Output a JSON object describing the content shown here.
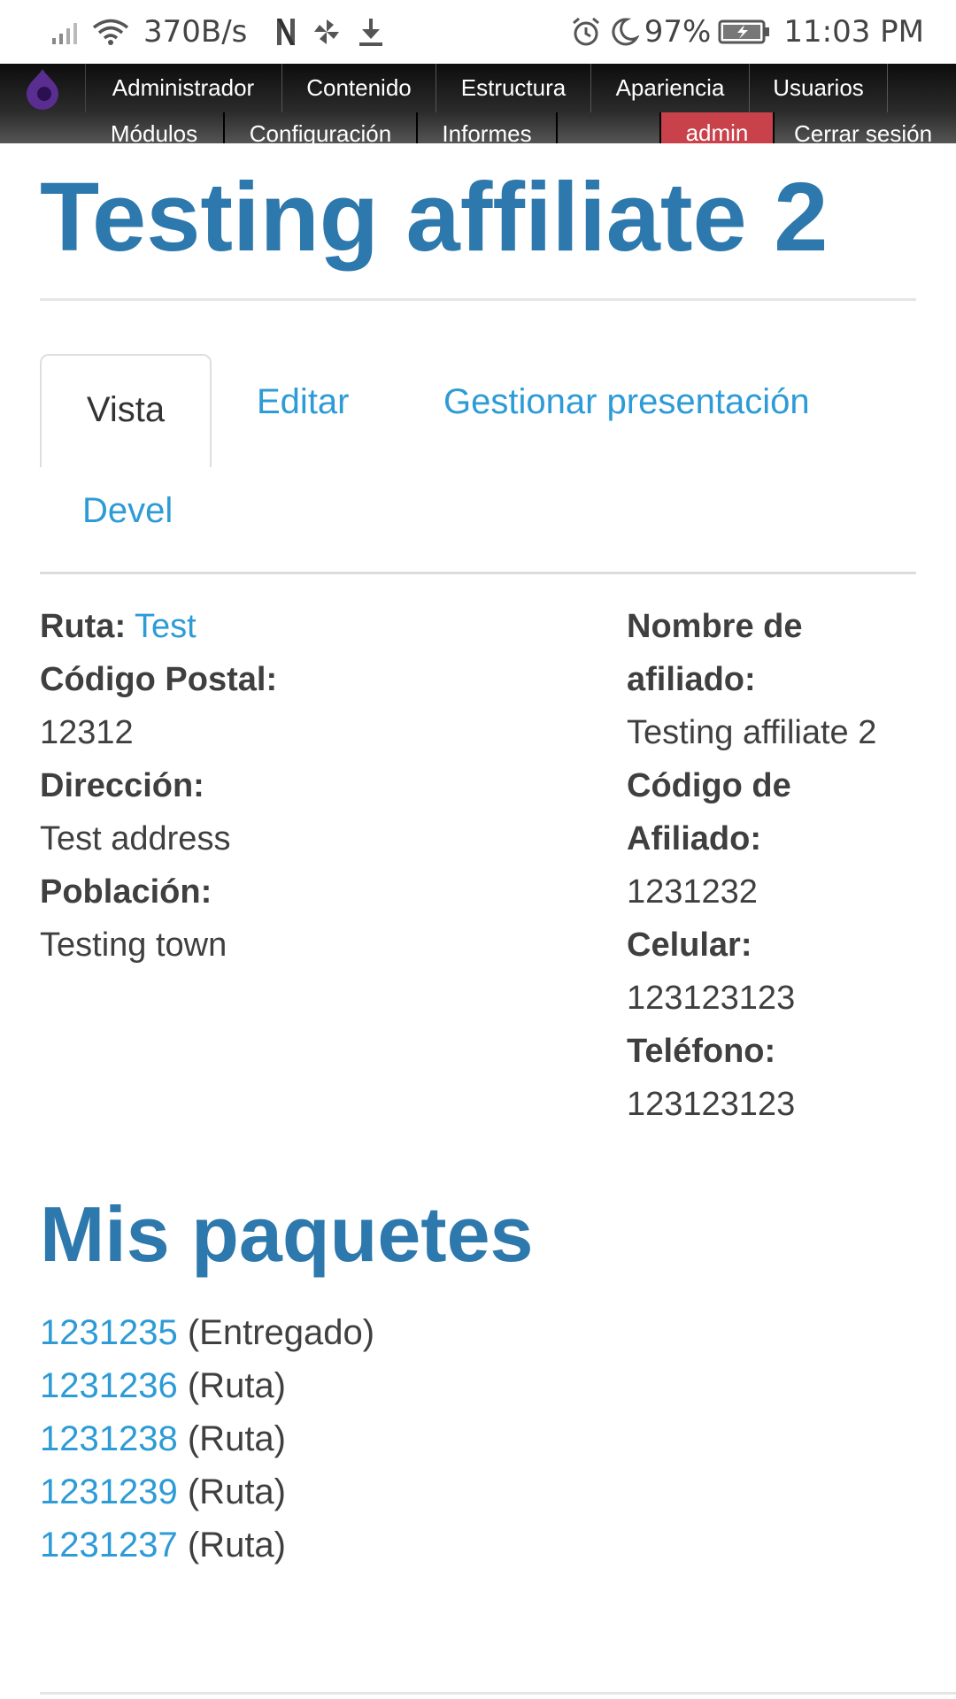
{
  "status_bar": {
    "net_speed": "370B/s",
    "battery": "97%",
    "time": "11:03 PM",
    "icons": [
      "signal-icon",
      "wifi-icon",
      "netflix-icon",
      "pinwheel-icon",
      "download-icon",
      "alarm-icon",
      "moon-icon",
      "battery-charging-icon"
    ]
  },
  "toolbar": {
    "logo": "drupal-logo-icon",
    "row1": [
      "Administrador",
      "Contenido",
      "Estructura",
      "Apariencia",
      "Usuarios"
    ],
    "row2": [
      "Módulos",
      "Configuración",
      "Informes"
    ],
    "admin": "admin",
    "logout": "Cerrar sesión",
    "colors": {
      "admin_bg": "#c9414a",
      "bar_bg": "#1a1a1a"
    }
  },
  "page": {
    "title": "Testing affiliate 2",
    "tabs": {
      "active": "Vista",
      "edit": "Editar",
      "manage": "Gestionar presentación",
      "devel": "Devel"
    }
  },
  "details": {
    "left": {
      "route_label": "Ruta:",
      "route_value": "Test",
      "postal_label": "Código Postal:",
      "postal_value": "12312",
      "address_label": "Dirección:",
      "address_value": "Test address",
      "town_label": "Población:",
      "town_value": "Testing town"
    },
    "right": {
      "name_label_1": "Nombre de",
      "name_label_2": "afiliado:",
      "name_value": "Testing affiliate 2",
      "code_label_1": "Código de",
      "code_label_2": "Afiliado:",
      "code_value": "1231232",
      "cell_label": "Celular:",
      "cell_value": "123123123",
      "phone_label": "Teléfono:",
      "phone_value": "123123123"
    }
  },
  "packages": {
    "title": "Mis paquetes",
    "items": [
      {
        "id": "1231235",
        "status": "(Entregado)"
      },
      {
        "id": "1231236",
        "status": "(Ruta)"
      },
      {
        "id": "1231238",
        "status": "(Ruta)"
      },
      {
        "id": "1231239",
        "status": "(Ruta)"
      },
      {
        "id": "1231237",
        "status": "(Ruta)"
      }
    ]
  },
  "colors": {
    "heading": "#2d78ac",
    "link": "#2d9bd6",
    "text": "#3f3f3f"
  }
}
